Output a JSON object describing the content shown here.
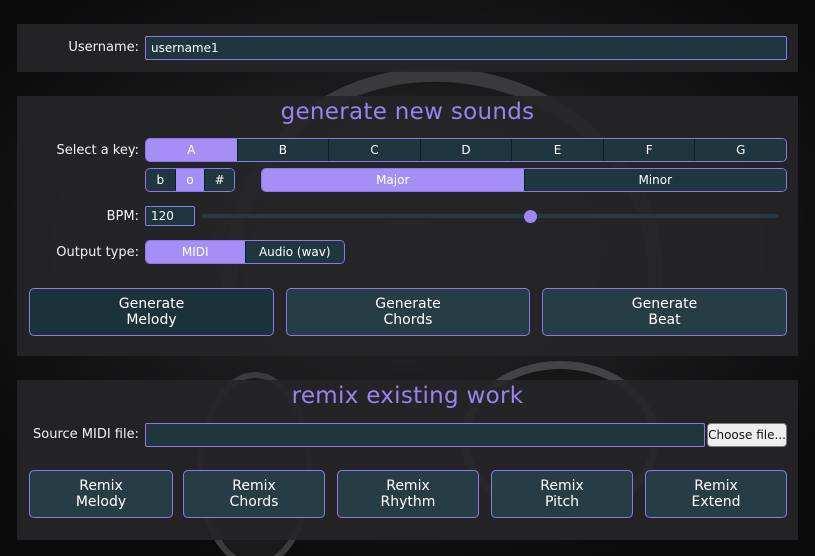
{
  "user": {
    "label": "Username:",
    "value": "username1"
  },
  "generate": {
    "title": "generate new sounds",
    "key": {
      "label": "Select a key:",
      "notes": [
        "A",
        "B",
        "C",
        "D",
        "E",
        "F",
        "G"
      ],
      "selected_note": "A",
      "accidentals": [
        "b",
        "o",
        "#"
      ],
      "selected_accidental": "o",
      "scales": [
        "Major",
        "Minor"
      ],
      "selected_scale": "Major"
    },
    "bpm": {
      "label": "BPM:",
      "value": "120",
      "slider_fraction": 0.57
    },
    "output": {
      "label": "Output type:",
      "options": [
        "MIDI",
        "Audio (wav)"
      ],
      "selected": "MIDI"
    },
    "buttons": [
      "Generate\nMelody",
      "Generate\nChords",
      "Generate\nBeat"
    ]
  },
  "remix": {
    "title": "remix existing work",
    "source": {
      "label": "Source MIDI file:",
      "value": "",
      "choose_label": "Choose file..."
    },
    "buttons": [
      "Remix\nMelody",
      "Remix\nChords",
      "Remix\nRhythm",
      "Remix\nPitch",
      "Remix\nExtend"
    ]
  },
  "colors": {
    "accent": "#9a82f0",
    "active": "#a48ff6",
    "field": "#1f363f",
    "panel": "#262628"
  }
}
